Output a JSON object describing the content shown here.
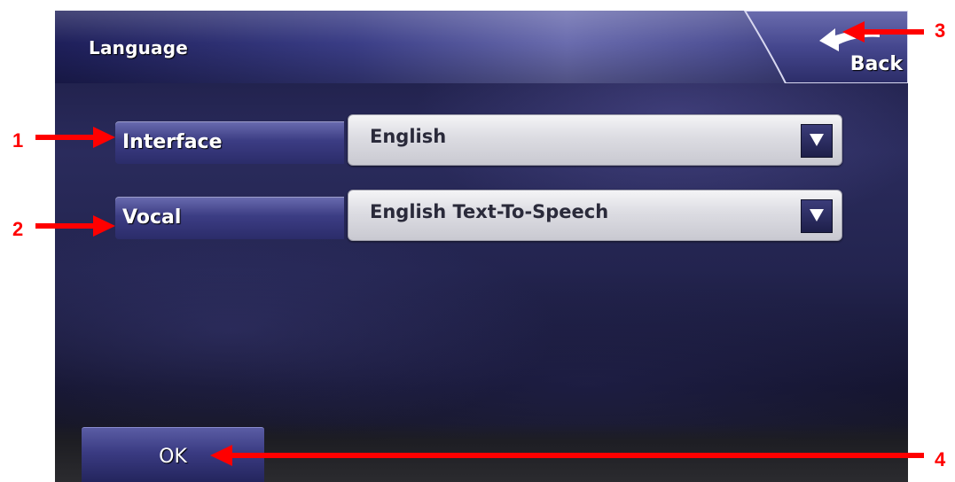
{
  "titlebar": {
    "title": "Language"
  },
  "back_button": {
    "label": "Back",
    "icon": "back-arrow-icon"
  },
  "settings": [
    {
      "label": "Interface",
      "value": "English",
      "icon": "dropdown-arrow-icon"
    },
    {
      "label": "Vocal",
      "value": "English Text-To-Speech",
      "icon": "dropdown-arrow-icon"
    }
  ],
  "footer": {
    "ok_label": "OK"
  },
  "annotations": [
    {
      "number": "1",
      "target": "interface-label"
    },
    {
      "number": "2",
      "target": "vocal-label"
    },
    {
      "number": "3",
      "target": "back-button"
    },
    {
      "number": "4",
      "target": "ok-button"
    }
  ],
  "colors": {
    "annotation": "#ff0000",
    "titlebar_accent": "#3a3d86",
    "dropdown_bg": "#dcdce2",
    "background": "#1a1a40"
  }
}
